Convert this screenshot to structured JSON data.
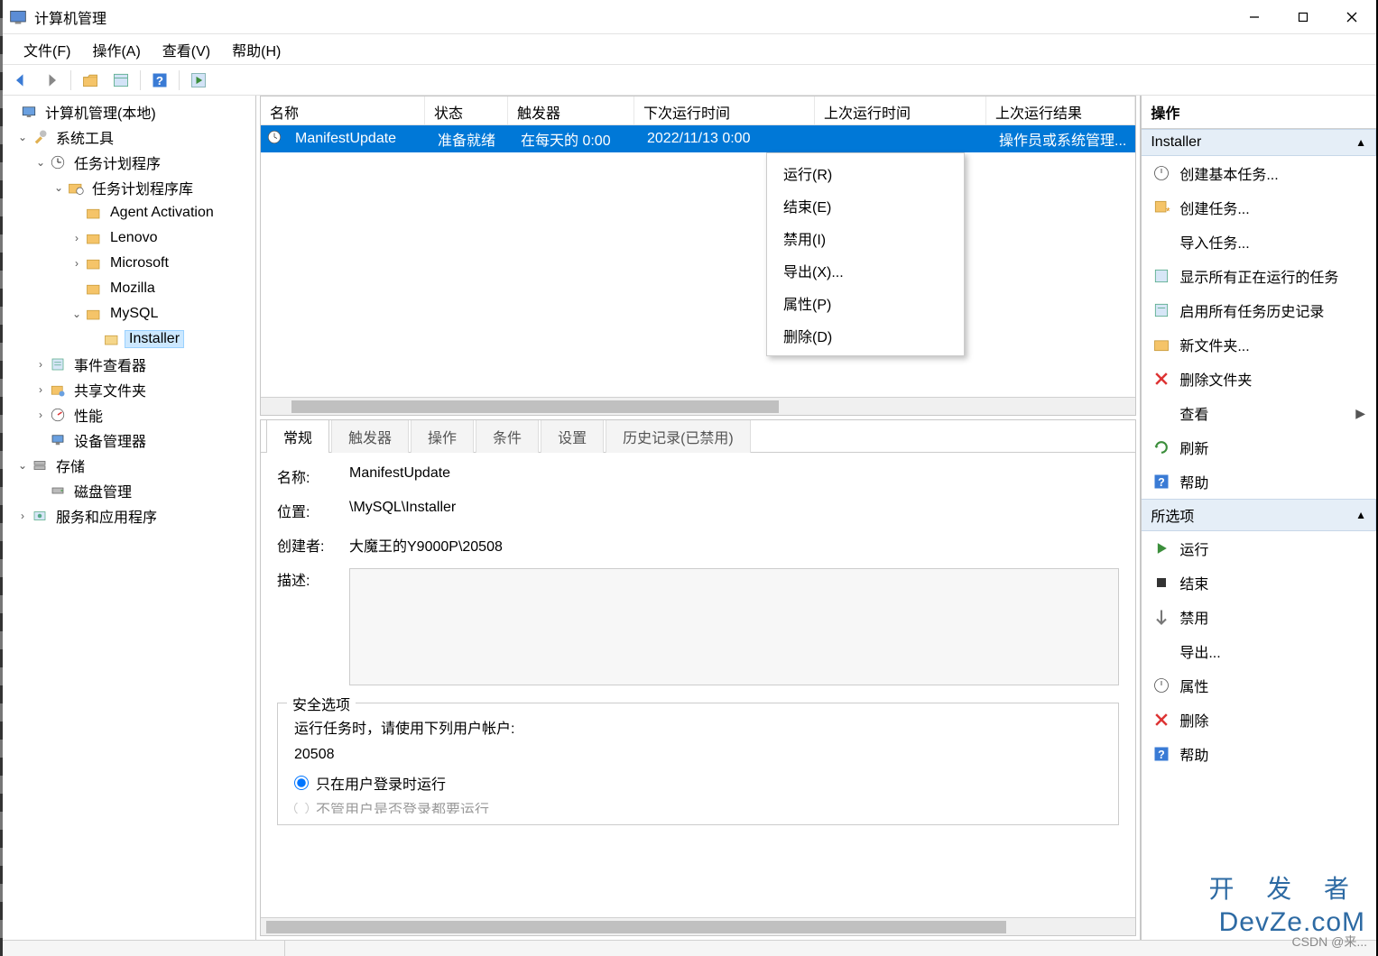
{
  "window": {
    "title": "计算机管理"
  },
  "menu": {
    "file": "文件(F)",
    "action": "操作(A)",
    "view": "查看(V)",
    "help": "帮助(H)"
  },
  "tree": {
    "root": "计算机管理(本地)",
    "systemTools": "系统工具",
    "taskScheduler": "任务计划程序",
    "taskLib": "任务计划程序库",
    "agent": "Agent Activation",
    "lenovo": "Lenovo",
    "microsoft": "Microsoft",
    "mozilla": "Mozilla",
    "mysql": "MySQL",
    "installer": "Installer",
    "eventViewer": "事件查看器",
    "sharedFolders": "共享文件夹",
    "performance": "性能",
    "deviceManager": "设备管理器",
    "storage": "存储",
    "diskManagement": "磁盘管理",
    "servicesApps": "服务和应用程序"
  },
  "list": {
    "cols": {
      "name": "名称",
      "status": "状态",
      "trigger": "触发器",
      "nextRun": "下次运行时间",
      "lastRun": "上次运行时间",
      "lastResult": "上次运行结果"
    },
    "row": {
      "name": "ManifestUpdate",
      "status": "准备就绪",
      "trigger": "在每天的 0:00",
      "nextRun": "2022/11/13 0:00",
      "lastRun": "",
      "lastResult": "操作员或系统管理..."
    }
  },
  "contextMenu": {
    "run": "运行(R)",
    "end": "结束(E)",
    "disable": "禁用(I)",
    "export": "导出(X)...",
    "properties": "属性(P)",
    "delete": "删除(D)"
  },
  "tabs": {
    "general": "常规",
    "triggers": "触发器",
    "actions": "操作",
    "conditions": "条件",
    "settings": "设置",
    "history": "历史记录(已禁用)"
  },
  "detail": {
    "nameLabel": "名称:",
    "name": "ManifestUpdate",
    "locationLabel": "位置:",
    "location": "\\MySQL\\Installer",
    "authorLabel": "创建者:",
    "author": "大魔王的Y9000P\\20508",
    "descLabel": "描述:",
    "securityGroup": "安全选项",
    "runAsLabel": "运行任务时，请使用下列用户帐户:",
    "runAsUser": "20508",
    "radio1": "只在用户登录时运行",
    "radio2cut": "不管用户是否登录都要运行"
  },
  "actions": {
    "panelTitle": "操作",
    "section1": "Installer",
    "createBasic": "创建基本任务...",
    "createTask": "创建任务...",
    "importTask": "导入任务...",
    "showRunning": "显示所有正在运行的任务",
    "enableHistory": "启用所有任务历史记录",
    "newFolder": "新文件夹...",
    "deleteFolder": "删除文件夹",
    "view": "查看",
    "refresh": "刷新",
    "help": "帮助",
    "section2": "所选项",
    "run": "运行",
    "end": "结束",
    "disable": "禁用",
    "export": "导出...",
    "properties": "属性",
    "delete": "删除",
    "help2": "帮助"
  },
  "branding": {
    "kaifazhe": "开 发 者",
    "devz": "DevZe.coM",
    "csdn": "CSDN @来..."
  }
}
